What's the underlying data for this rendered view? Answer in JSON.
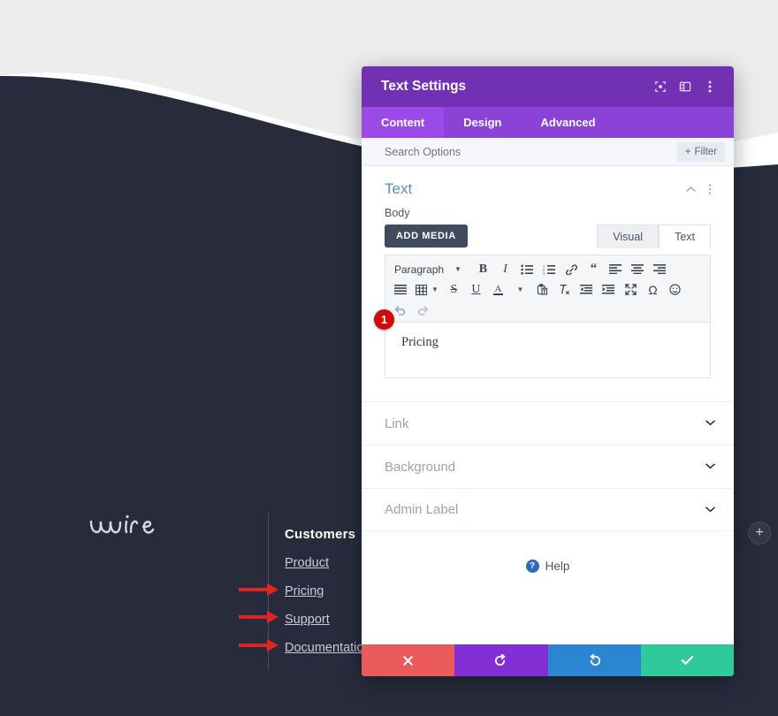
{
  "colors": {
    "page_bg": "#272b3c",
    "hero_grey": "#ededed",
    "hero_white": "#ffffff",
    "modal_header": "#7230b3",
    "modal_tabs": "#8b42d6",
    "tab_active": "#9b4ae8",
    "accent_link": "#4f93c8",
    "annotation_red": "#e02424",
    "badge_red": "#cf0a0a",
    "cancel": "#ea5a5a",
    "undo": "#8230d6",
    "redo": "#2b86d1",
    "save": "#2fc99a"
  },
  "background_page": {
    "brand_logo": "wire",
    "footer": {
      "column_title": "Customers",
      "links": [
        "Product",
        "Pricing",
        "Support",
        "Documentation"
      ]
    },
    "add_section_button": "+"
  },
  "annotations": {
    "step_badge": "1",
    "arrows": [
      "arrow-pricing",
      "arrow-support",
      "arrow-documentation"
    ]
  },
  "modal": {
    "title": "Text Settings",
    "header_icons": [
      "target-icon",
      "layout-panel-icon",
      "more-vertical-icon"
    ],
    "tabs": [
      {
        "label": "Content",
        "active": true
      },
      {
        "label": "Design",
        "active": false
      },
      {
        "label": "Advanced",
        "active": false
      }
    ],
    "search": {
      "placeholder": "Search Options",
      "filter_label": "Filter",
      "filter_prefix": "+"
    },
    "text_section": {
      "title": "Text",
      "collapse_icon": "chevron-up-icon",
      "menu_icon": "more-vertical-icon",
      "body_label": "Body",
      "add_media_label": "ADD MEDIA",
      "mode_tabs": [
        {
          "label": "Visual",
          "active": true
        },
        {
          "label": "Text",
          "active": false
        }
      ],
      "toolbar": {
        "format_select": "Paragraph",
        "row1": [
          "bold-icon",
          "italic-icon",
          "bulleted-list-icon",
          "numbered-list-icon",
          "link-icon",
          "blockquote-icon",
          "align-left-icon",
          "align-center-icon",
          "align-right-icon"
        ],
        "row2": [
          "align-justify-icon",
          "table-icon",
          "strikethrough-icon",
          "underline-icon",
          "text-color-icon",
          "paste-as-text-icon",
          "clear-formatting-icon",
          "outdent-icon",
          "indent-icon",
          "fullscreen-icon",
          "special-character-icon",
          "emoji-icon"
        ],
        "row3": [
          "undo-icon",
          "redo-icon"
        ]
      },
      "editor_content": "Pricing"
    },
    "accordions": [
      {
        "label": "Link",
        "chevron": "chevron-down-icon"
      },
      {
        "label": "Background",
        "chevron": "chevron-down-icon"
      },
      {
        "label": "Admin Label",
        "chevron": "chevron-down-icon"
      }
    ],
    "help": {
      "label": "Help",
      "icon": "question-mark-icon"
    },
    "actions": [
      {
        "name": "cancel",
        "icon": "close-x-icon"
      },
      {
        "name": "undo",
        "icon": "undo-arrow-icon"
      },
      {
        "name": "redo",
        "icon": "redo-arrow-icon"
      },
      {
        "name": "save",
        "icon": "checkmark-icon"
      }
    ]
  }
}
